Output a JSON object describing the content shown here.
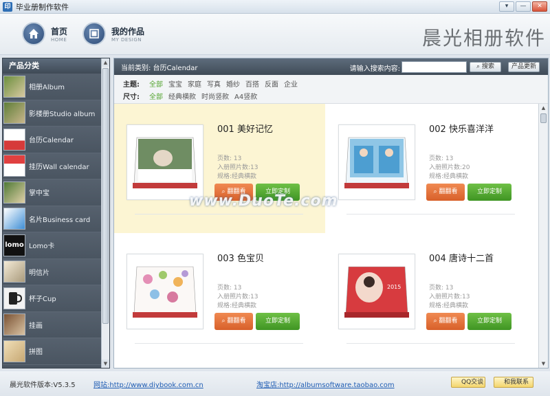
{
  "window": {
    "title": "毕业册制作软件",
    "minimize": "▾",
    "restore": "—",
    "close": "✕"
  },
  "header": {
    "nav": [
      {
        "cn": "首页",
        "en": "HOME"
      },
      {
        "cn": "我的作品",
        "en": "MY DESIGN"
      }
    ],
    "brand": "晨光相册软件"
  },
  "sidebar": {
    "title": "产品分类",
    "items": [
      {
        "label": "相册Album"
      },
      {
        "label": "影楼册Studio album"
      },
      {
        "label": "台历Calendar"
      },
      {
        "label": "挂历Wall calendar"
      },
      {
        "label": "掌中宝"
      },
      {
        "label": "名片Business card"
      },
      {
        "label": "Lomo卡"
      },
      {
        "label": "明信片"
      },
      {
        "label": "杯子Cup"
      },
      {
        "label": "挂画"
      },
      {
        "label": "拼图"
      }
    ],
    "thumb_labels": {
      "lomo": "lomo"
    }
  },
  "main": {
    "current_category": "当前类别: 台历Calendar",
    "search_label": "请输入搜索内容:",
    "search_value": "",
    "search_button": "搜索",
    "update_button": "产品更新",
    "filters": {
      "theme_label": "主题:",
      "themes": [
        "全部",
        "宝宝",
        "家庭",
        "写真",
        "婚纱",
        "百搭",
        "反面",
        "企业"
      ],
      "size_label": "尺寸:",
      "sizes": [
        "全部",
        "经典横款",
        "时尚竖款",
        "A4竖款"
      ]
    },
    "products": [
      {
        "title": "001  美好记忆",
        "pages": "页数:  13",
        "photos": "入册照片数:13",
        "spec": "规格:经典横款",
        "view": "翻翻看",
        "custom": "立即定制"
      },
      {
        "title": "002  快乐喜洋洋",
        "pages": "页数:  13",
        "photos": "入册照片数:20",
        "spec": "规格:经典横款",
        "view": "翻翻看",
        "custom": "立即定制"
      },
      {
        "title": "003  色宝贝",
        "pages": "页数:  13",
        "photos": "入册照片数:13",
        "spec": "规格:经典横款",
        "view": "翻翻看",
        "custom": "立即定制"
      },
      {
        "title": "004  唐诗十二首",
        "pages": "页数:  13",
        "photos": "入册照片数:13",
        "spec": "规格:经典横款",
        "view": "翻翻看",
        "custom": "立即定制"
      }
    ],
    "thumb_year": "2015",
    "watermark": "www.DuoTe.com"
  },
  "footer": {
    "version": "晨光软件版本:V5.3.5",
    "site": "网站:http://www.diybook.com.cn",
    "shop": "淘宝店:http://albumsoftware.taobao.com",
    "qq": "QQ交谈",
    "contact": "和我联系"
  }
}
